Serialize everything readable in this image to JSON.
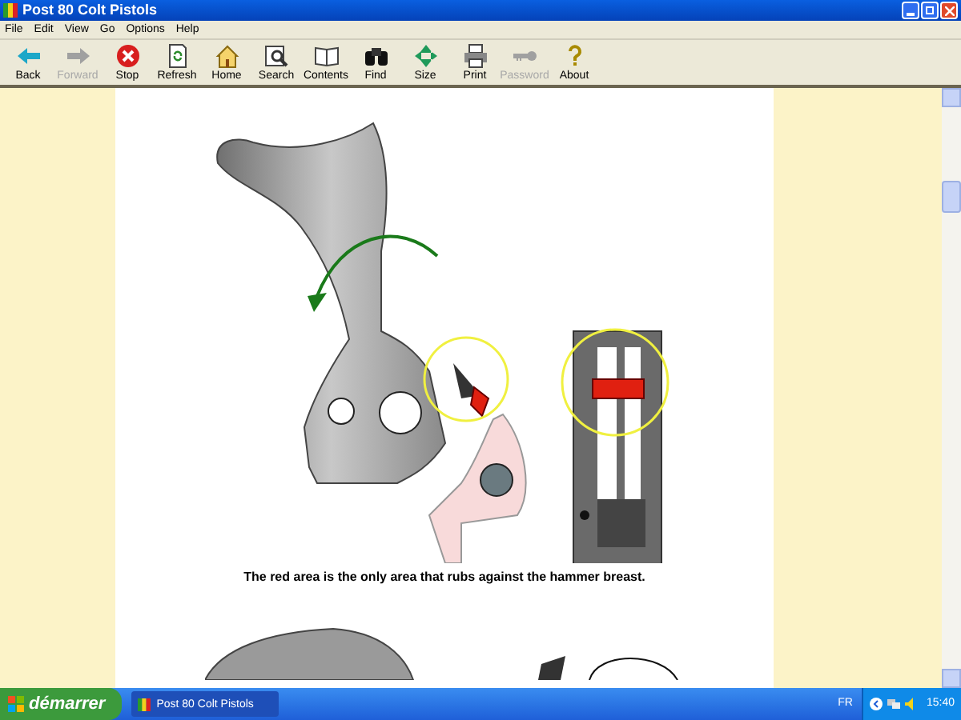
{
  "window": {
    "title": "Post 80 Colt Pistols"
  },
  "menu": [
    "File",
    "Edit",
    "View",
    "Go",
    "Options",
    "Help"
  ],
  "toolbar": [
    {
      "label": "Back",
      "kind": "back",
      "disabled": false
    },
    {
      "label": "Forward",
      "kind": "forward",
      "disabled": true
    },
    {
      "label": "Stop",
      "kind": "stop",
      "disabled": false
    },
    {
      "label": "Refresh",
      "kind": "refresh",
      "disabled": false
    },
    {
      "label": "Home",
      "kind": "home",
      "disabled": false
    },
    {
      "label": "Search",
      "kind": "search",
      "disabled": false
    },
    {
      "label": "Contents",
      "kind": "contents",
      "disabled": false
    },
    {
      "label": "Find",
      "kind": "find",
      "disabled": false
    },
    {
      "label": "Size",
      "kind": "size",
      "disabled": false
    },
    {
      "label": "Print",
      "kind": "print",
      "disabled": false
    },
    {
      "label": "Password",
      "kind": "password",
      "disabled": true
    },
    {
      "label": "About",
      "kind": "about",
      "disabled": false
    }
  ],
  "content": {
    "caption": "The red area is the only area that rubs against the hammer breast."
  },
  "taskbar": {
    "start": "démarrer",
    "tasks": [
      {
        "label": "Post 80 Colt Pistols",
        "selected": true
      }
    ],
    "language": "FR",
    "clock": "15:40"
  }
}
